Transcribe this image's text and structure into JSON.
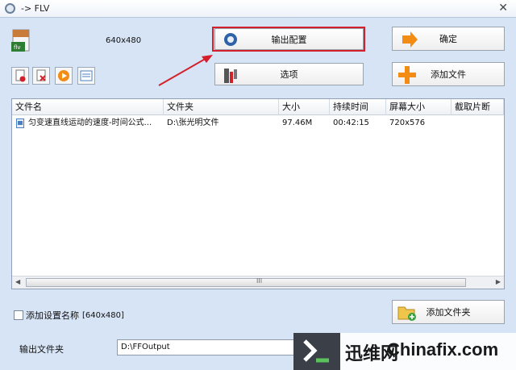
{
  "window": {
    "title": "-> FLV",
    "close_glyph": "✕"
  },
  "preview": {
    "resolution": "640x480",
    "format_badge": "flv"
  },
  "toolbar_icons": [
    {
      "name": "clear-icon",
      "color": "#d3202a"
    },
    {
      "name": "remove-icon",
      "color": "#d3202a"
    },
    {
      "name": "play-icon",
      "color": "#f28c14"
    },
    {
      "name": "info-icon",
      "color": "#4a7fc1"
    }
  ],
  "buttons": {
    "output_config": "输出配置",
    "options": "选项",
    "ok": "确定",
    "add_file": "添加文件",
    "add_folder": "添加文件夹"
  },
  "filelist": {
    "columns": [
      "文件名",
      "文件夹",
      "大小",
      "持续时间",
      "屏幕大小",
      "截取片断"
    ],
    "rows": [
      {
        "name": "匀变速直线运动的速度-时间公式...",
        "folder": "D:\\张光明文件",
        "size": "97.46M",
        "duration": "00:42:15",
        "screen": "720x576",
        "clip": ""
      }
    ],
    "scroll_grip": "III"
  },
  "settings": {
    "add_setting_name_label": "添加设置名称",
    "add_setting_name_value": "[640x480]",
    "checked": false
  },
  "output": {
    "label": "输出文件夹",
    "value": "D:\\FFOutput"
  },
  "watermark": {
    "brand_cn": "迅维网",
    "brand_en": "Chinafix.com"
  },
  "colors": {
    "highlight": "#d3202a",
    "background": "#d6e4f6",
    "accent_orange": "#f28c14"
  }
}
